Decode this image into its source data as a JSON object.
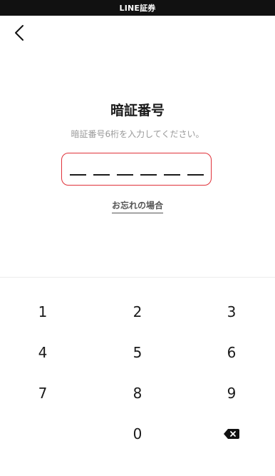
{
  "app_bar": {
    "title": "LINE証券"
  },
  "header": {
    "back_icon": "chevron-left-icon"
  },
  "main": {
    "title": "暗証番号",
    "instruction": "暗証番号6桁を入力してください。",
    "pin": {
      "length": 6,
      "entered": 0,
      "border_color": "#e0323a"
    },
    "forgot_link": "お忘れの場合"
  },
  "keypad": {
    "keys": [
      "1",
      "2",
      "3",
      "4",
      "5",
      "6",
      "7",
      "8",
      "9",
      "",
      "0",
      "⌫"
    ],
    "delete_icon": "backspace-icon"
  }
}
